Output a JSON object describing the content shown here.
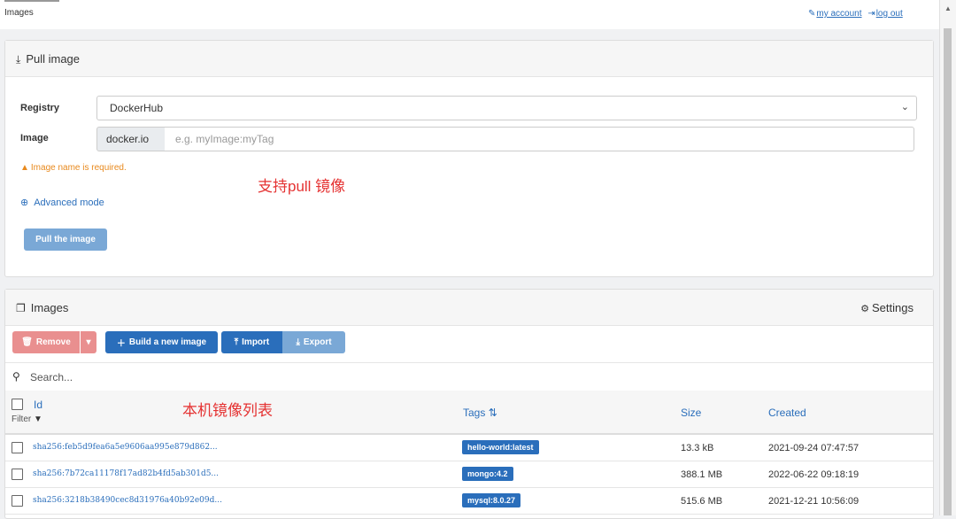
{
  "header": {
    "breadcrumb": "Images",
    "my_account": "my account",
    "log_out": "log out"
  },
  "pull_panel": {
    "title": "Pull image",
    "registry_label": "Registry",
    "registry_value": "DockerHub",
    "image_label": "Image",
    "image_prefix": "docker.io",
    "image_placeholder": "e.g. myImage:myTag",
    "warning": "Image name is required.",
    "advanced_mode": "Advanced mode",
    "pull_button": "Pull the image",
    "annotation": "支持pull 镜像"
  },
  "images_panel": {
    "title": "Images",
    "settings": "Settings",
    "buttons": {
      "remove": "Remove",
      "build": "Build a new image",
      "import": "Import",
      "export": "Export"
    },
    "search_placeholder": "Search...",
    "annotation": "本机镜像列表",
    "columns": {
      "id": "Id",
      "filter": "Filter",
      "tags": "Tags",
      "size": "Size",
      "created": "Created"
    },
    "rows": [
      {
        "id": "sha256:feb5d9fea6a5e9606aa995e879d862...",
        "tag": "hello-world:latest",
        "size": "13.3 kB",
        "created": "2021-09-24 07:47:57"
      },
      {
        "id": "sha256:7b72ca11178f17ad82b4fd5ab301d5...",
        "tag": "mongo:4.2",
        "size": "388.1 MB",
        "created": "2022-06-22 09:18:19"
      },
      {
        "id": "sha256:3218b38490cec8d31976a40b92e09d...",
        "tag": "mysql:8.0.27",
        "size": "515.6 MB",
        "created": "2021-12-21 10:56:09"
      }
    ]
  }
}
